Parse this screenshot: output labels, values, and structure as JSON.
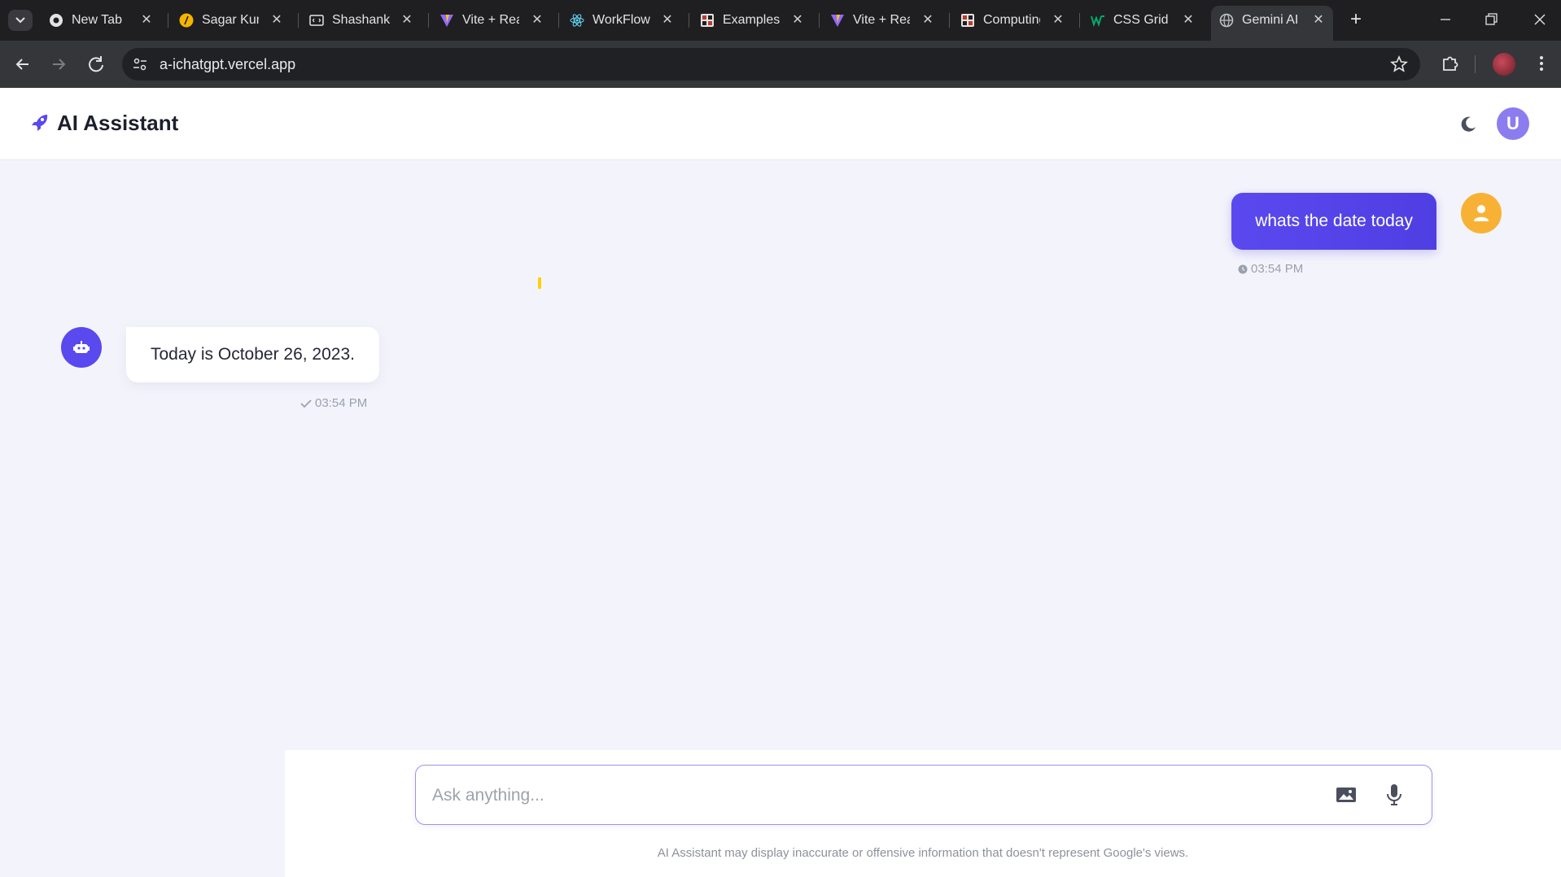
{
  "browser": {
    "tabs": [
      {
        "title": "New Tab",
        "icon": "chrome-icon"
      },
      {
        "title": "Sagar Kum",
        "icon": "slash-icon"
      },
      {
        "title": "Shashank",
        "icon": "code-window-icon"
      },
      {
        "title": "Vite + Rea",
        "icon": "vite-icon"
      },
      {
        "title": "WorkFlow",
        "icon": "react-icon"
      },
      {
        "title": "Examples -",
        "icon": "grid-icon"
      },
      {
        "title": "Vite + Rea",
        "icon": "vite-icon"
      },
      {
        "title": "Computing",
        "icon": "grid-icon"
      },
      {
        "title": "CSS Grid C",
        "icon": "w3-icon"
      },
      {
        "title": "Gemini AI",
        "icon": "globe-icon",
        "active": true
      }
    ],
    "url": "a-ichatgpt.vercel.app"
  },
  "app": {
    "brand": "AI Assistant",
    "user_initial": "U",
    "accent": "#5a49ee"
  },
  "chat": {
    "user_message": {
      "text": "whats the date today",
      "time": "03:54 PM"
    },
    "bot_message": {
      "text": "Today is October 26, 2023.",
      "time": "03:54 PM"
    }
  },
  "composer": {
    "placeholder": "Ask anything...",
    "disclaimer": "AI Assistant may display inaccurate or offensive information that doesn't represent Google's views."
  }
}
